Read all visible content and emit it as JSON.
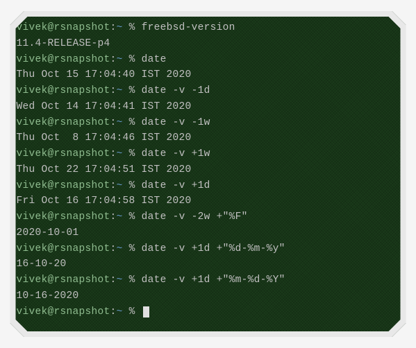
{
  "prompt": {
    "user": "vivek",
    "at": "@",
    "host": "rsnapshot",
    "colon": ":",
    "path": "~",
    "symbol": " % "
  },
  "lines": [
    {
      "type": "cmd",
      "text": "freebsd-version"
    },
    {
      "type": "out",
      "text": "11.4-RELEASE-p4"
    },
    {
      "type": "cmd",
      "text": "date"
    },
    {
      "type": "out",
      "text": "Thu Oct 15 17:04:40 IST 2020"
    },
    {
      "type": "cmd",
      "text": "date -v -1d"
    },
    {
      "type": "out",
      "text": "Wed Oct 14 17:04:41 IST 2020"
    },
    {
      "type": "cmd",
      "text": "date -v -1w"
    },
    {
      "type": "out",
      "text": "Thu Oct  8 17:04:46 IST 2020"
    },
    {
      "type": "cmd",
      "text": "date -v +1w"
    },
    {
      "type": "out",
      "text": "Thu Oct 22 17:04:51 IST 2020"
    },
    {
      "type": "cmd",
      "text": "date -v +1d"
    },
    {
      "type": "out",
      "text": "Fri Oct 16 17:04:58 IST 2020"
    },
    {
      "type": "cmd",
      "text": "date -v -2w +\"%F\""
    },
    {
      "type": "out",
      "text": "2020-10-01"
    },
    {
      "type": "cmd",
      "text": "date -v +1d +\"%d-%m-%y\""
    },
    {
      "type": "out",
      "text": "16-10-20"
    },
    {
      "type": "cmd",
      "text": "date -v +1d +\"%m-%d-%Y\""
    },
    {
      "type": "out",
      "text": "10-16-2020"
    },
    {
      "type": "cmd",
      "text": "",
      "cursor": true
    }
  ]
}
